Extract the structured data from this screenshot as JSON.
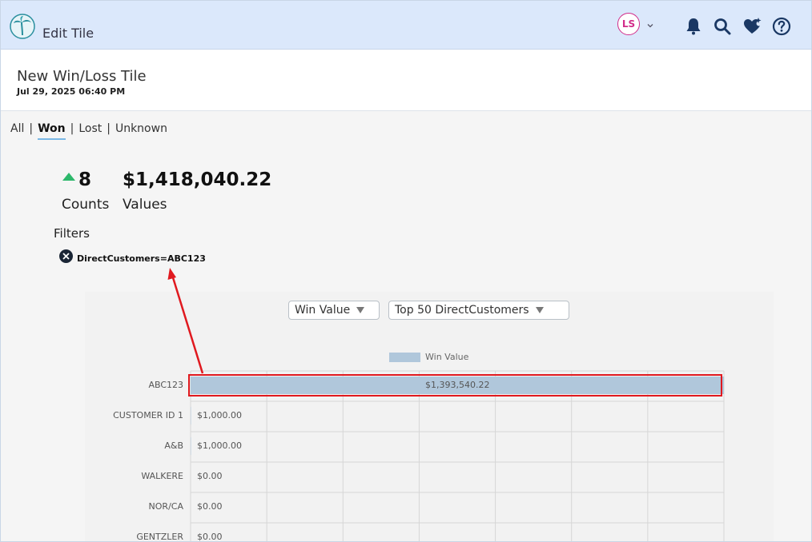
{
  "app": {
    "title": "Edit Tile",
    "user_initials": "LS"
  },
  "header_icons": [
    "palm-logo-icon",
    "chevron-down-icon",
    "bell-icon",
    "search-icon",
    "heart-sparkle-icon",
    "help-icon"
  ],
  "tile": {
    "title": "New Win/Loss Tile",
    "date": "Jul 29, 2025 06:40 PM"
  },
  "tabs": [
    {
      "label": "All",
      "active": false
    },
    {
      "label": "Won",
      "active": true
    },
    {
      "label": "Lost",
      "active": false
    },
    {
      "label": "Unknown",
      "active": false
    }
  ],
  "stats": {
    "count_value": "8",
    "count_label": "Counts",
    "money_value": "$1,418,040.22",
    "money_label": "Values"
  },
  "filters": {
    "label": "Filters",
    "items": [
      "DirectCustomers=ABC123"
    ]
  },
  "controls": {
    "measure": "Win Value",
    "grouping": "Top 50 DirectCustomers"
  },
  "colors": {
    "bar": "#b0c7db",
    "up_arrow": "#2db86b",
    "highlight": "#e0191f",
    "header_bg": "#dbe8fb",
    "icon_navy": "#1a3864"
  },
  "chart_data": {
    "type": "bar",
    "orientation": "horizontal",
    "categories": [
      "ABC123",
      "CUSTOMER ID 1",
      "A&B",
      "WALKERE",
      "NOR/CA",
      "GENTZLER"
    ],
    "series": [
      {
        "name": "Win Value",
        "values": [
          1393540.22,
          1000.0,
          1000.0,
          0,
          0,
          0
        ]
      }
    ],
    "value_labels": [
      "$1,393,540.22",
      "$1,000.00",
      "$1,000.00",
      "$0.00",
      "$0.00",
      "$0.00"
    ],
    "xlim": [
      0,
      1393540.22
    ],
    "legend": "top-center",
    "grid": true,
    "xlabel": "",
    "ylabel": "",
    "title": ""
  }
}
